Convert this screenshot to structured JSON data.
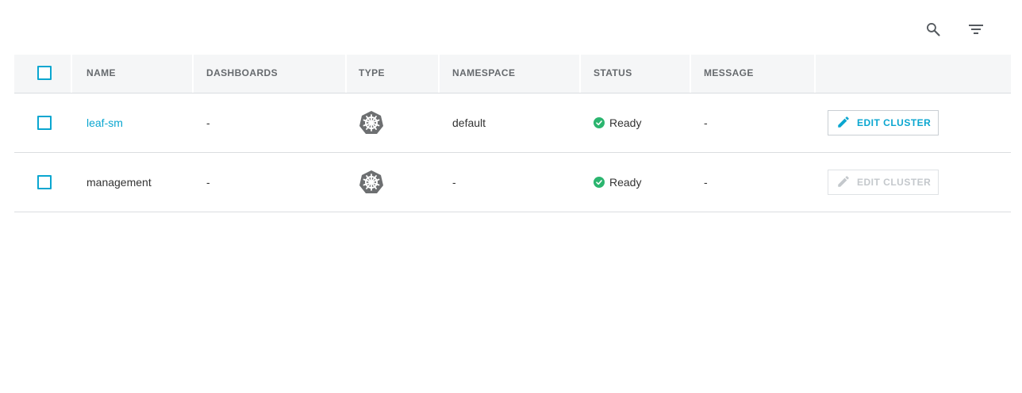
{
  "toolbar": {
    "search_icon": "search-icon",
    "filter_icon": "filter-icon"
  },
  "table": {
    "columns": [
      "NAME",
      "DASHBOARDS",
      "TYPE",
      "NAMESPACE",
      "STATUS",
      "MESSAGE"
    ],
    "rows": [
      {
        "name": "leaf-sm",
        "dashboards": "-",
        "type_icon": "kubernetes-icon",
        "namespace": "default",
        "status": "Ready",
        "message": "-",
        "action": "EDIT CLUSTER",
        "action_enabled": true
      },
      {
        "name": "management",
        "dashboards": "-",
        "type_icon": "kubernetes-icon",
        "namespace": "-",
        "status": "Ready",
        "message": "-",
        "action": "EDIT CLUSTER",
        "action_enabled": false
      }
    ]
  },
  "colors": {
    "accent": "#0aa6d0",
    "status_ready": "#2bb56f",
    "header_bg": "#f5f6f7"
  }
}
